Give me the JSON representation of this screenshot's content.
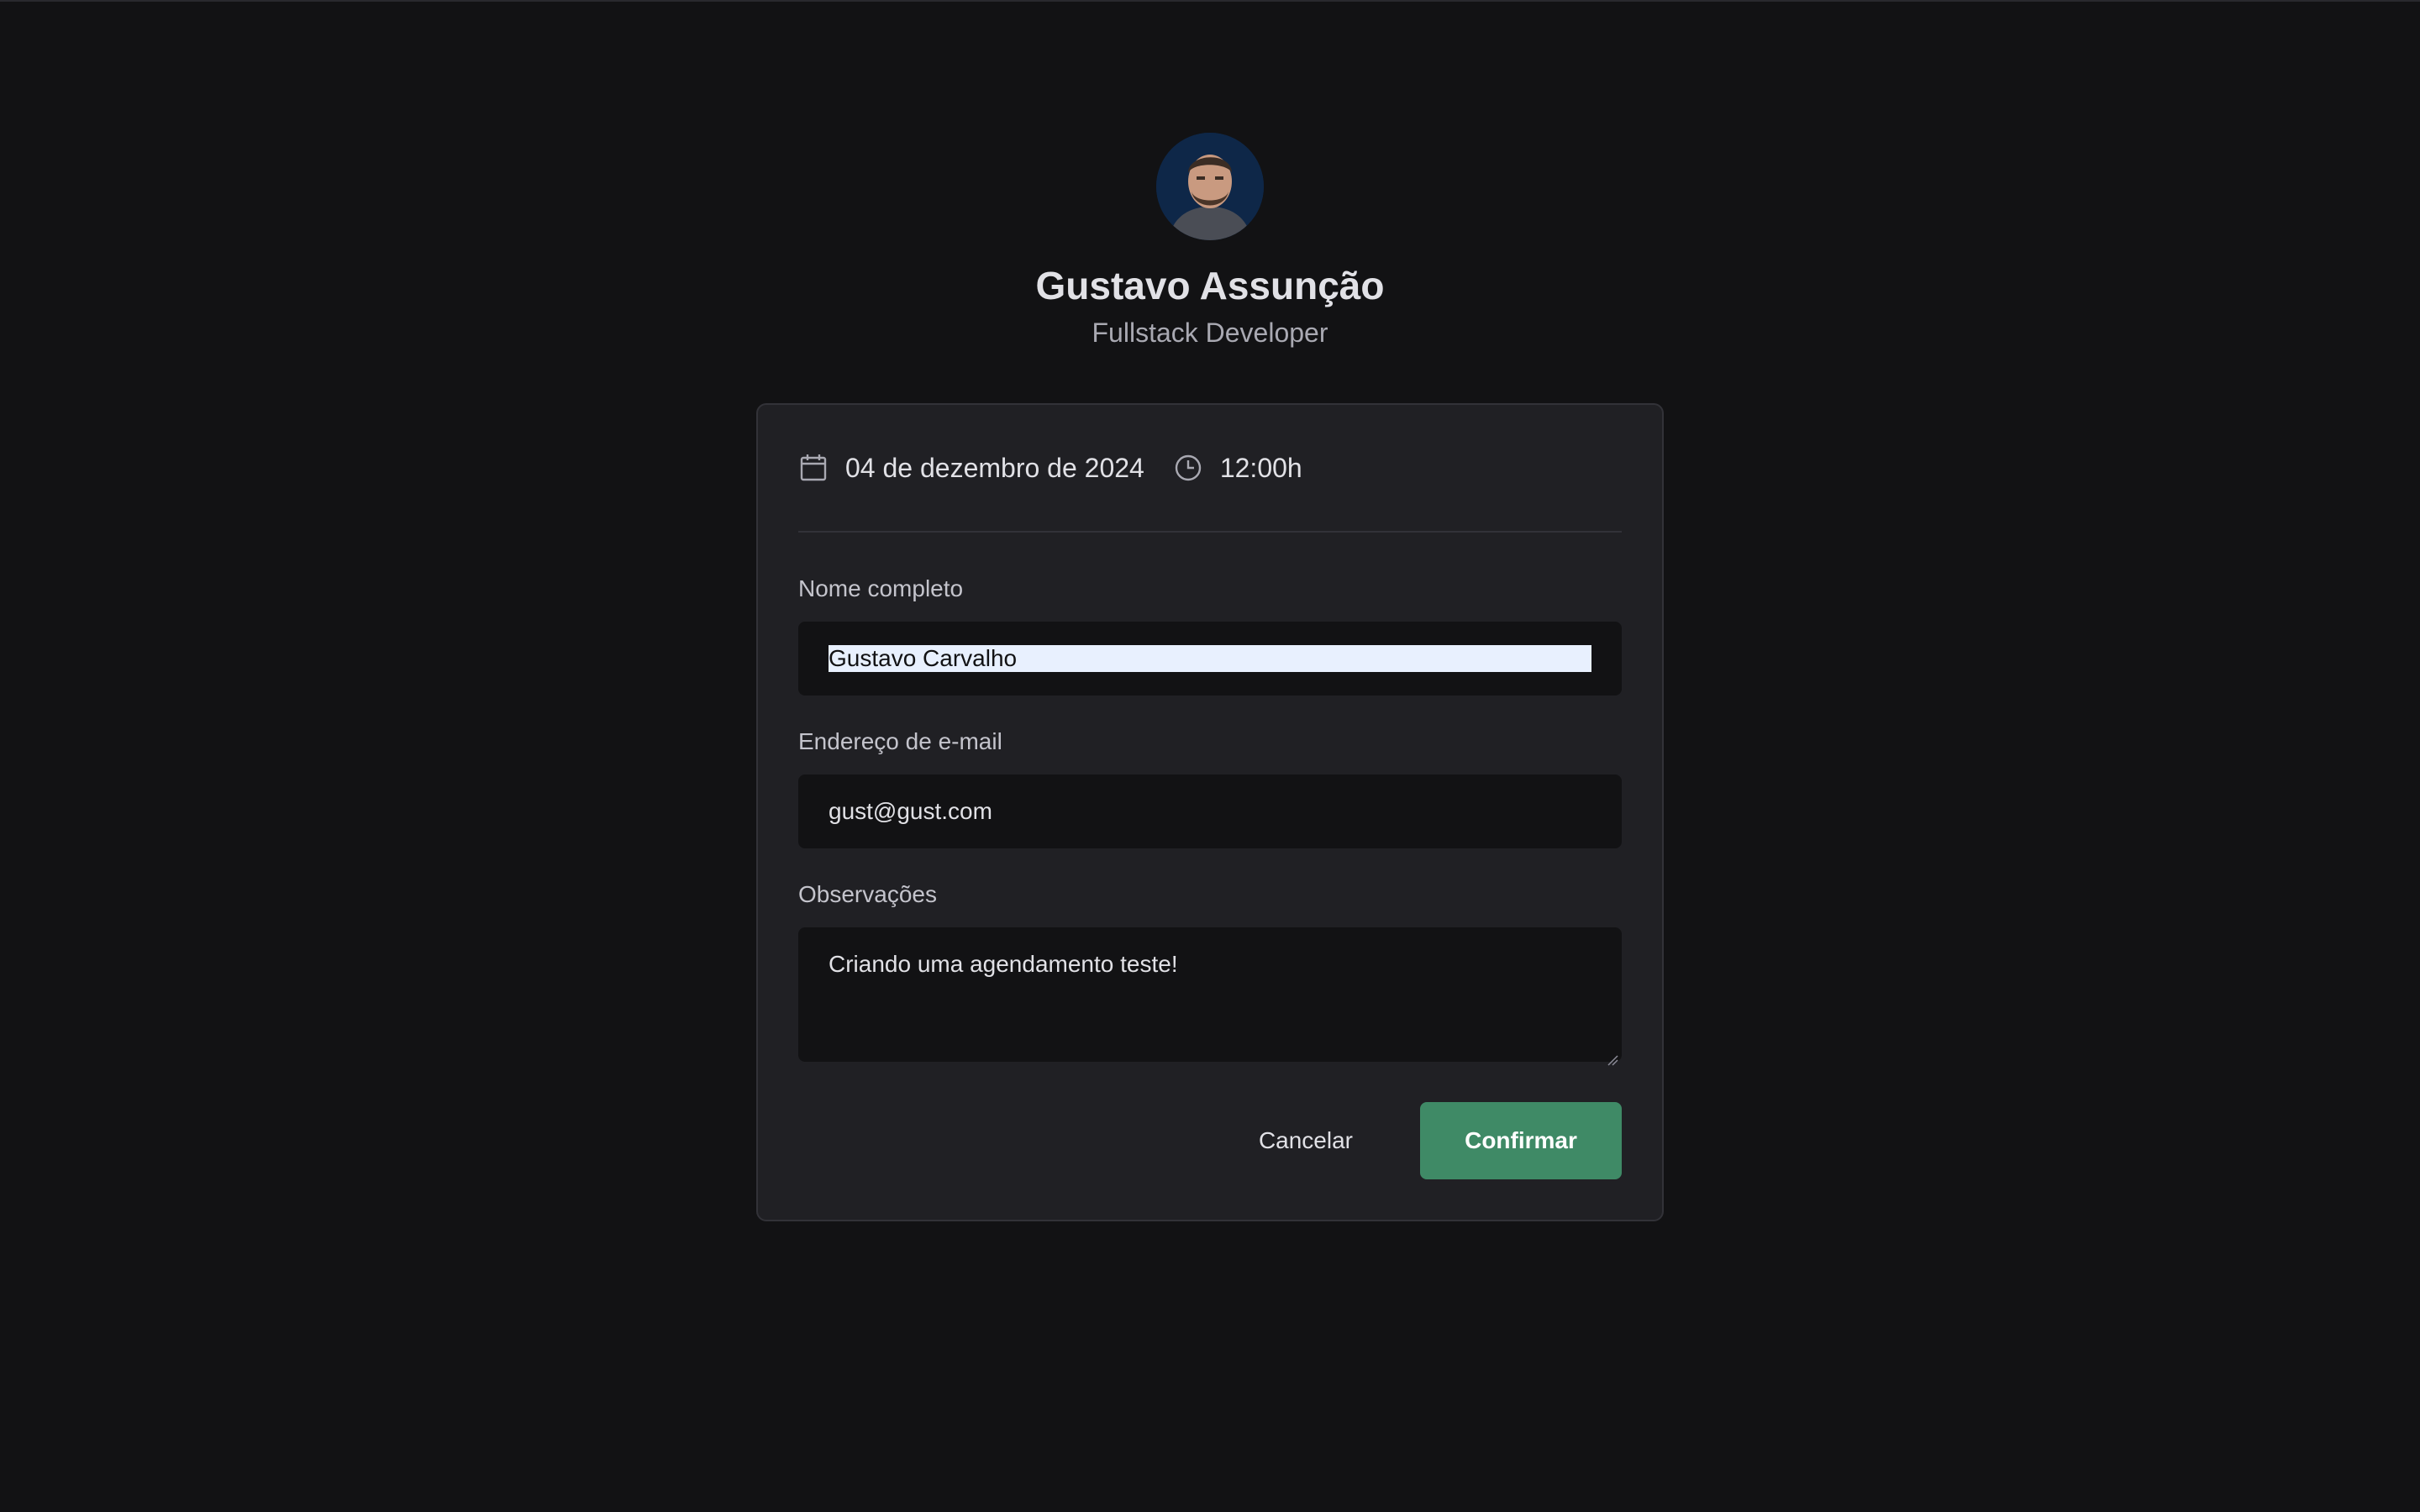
{
  "profile": {
    "name": "Gustavo Assunção",
    "role": "Fullstack Developer"
  },
  "schedule": {
    "date": "04 de dezembro de 2024",
    "time": "12:00h",
    "calendar_icon": "calendar-icon",
    "clock_icon": "clock-icon"
  },
  "form": {
    "name_label": "Nome completo",
    "name_value": "Gustavo Carvalho",
    "email_label": "Endereço de e-mail",
    "email_value": "gust@gust.com",
    "notes_label": "Observações",
    "notes_value": "Criando uma agendamento teste!"
  },
  "actions": {
    "cancel_label": "Cancelar",
    "confirm_label": "Confirmar"
  },
  "colors": {
    "background": "#121214",
    "card": "#202024",
    "accent": "#3f8a66",
    "selection": "#e8f0fe"
  }
}
